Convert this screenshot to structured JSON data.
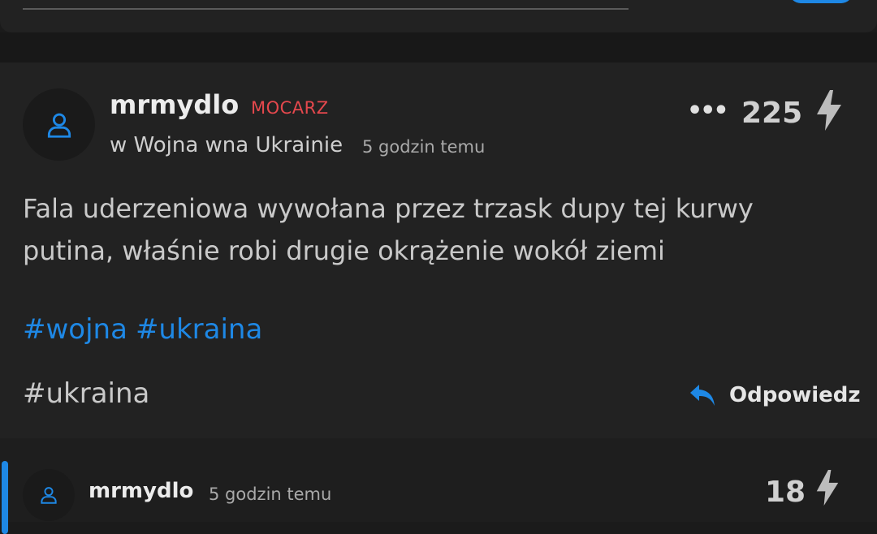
{
  "post": {
    "username": "mrmydlo",
    "rank": "MOCARZ",
    "community": "w Wojna wna Ukrainie",
    "timestamp": "5 godzin temu",
    "score": "225",
    "more_label": "•••",
    "body": "Fala uderzeniowa wywołana przez trzask dupy tej kurwy putina, właśnie robi drugie okrążenie wokół ziemi",
    "tags": [
      "#wojna",
      "#ukraina"
    ],
    "plain_tag": "#ukraina",
    "reply_label": "Odpowiedz"
  },
  "reply": {
    "username": "mrmydlo",
    "timestamp": "5 godzin temu",
    "score": "18"
  },
  "icons": {
    "avatar": "user-icon",
    "vote": "lightning-icon",
    "reply": "reply-arrow-icon",
    "more": "more-icon"
  },
  "colors": {
    "accent": "#1e88e5",
    "rank": "#e5484d",
    "background": "#1b1b1b",
    "card": "#222222"
  }
}
